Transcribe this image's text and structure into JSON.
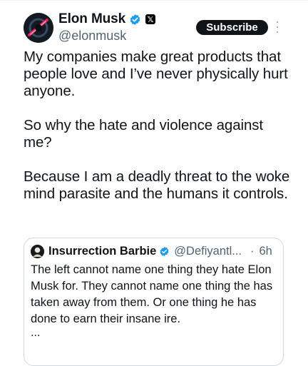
{
  "author": {
    "display_name": "Elon Musk",
    "handle": "@elonmusk",
    "badges": [
      "verified-badge-icon",
      "x-affiliate-icon"
    ]
  },
  "actions": {
    "subscribe_label": "Subscribe",
    "more_icon": "more-vertical-icon"
  },
  "tweet": {
    "paragraphs": [
      "My companies make great products that people love and I’ve never physically hurt anyone.",
      "So why the hate and violence against me?",
      "Because I am a deadly threat to the woke mind parasite and the humans it controls."
    ]
  },
  "quoted_tweet": {
    "display_name": "Insurrection Barbie",
    "handle": "@Defiyantl...",
    "separator": "·",
    "time": "6h",
    "text": "The left cannot name one thing they hate Elon Musk for. They cannot name one thing the has taken away from them. Or one thing he has done to earn their insane ire.",
    "ellipsis": "..."
  },
  "colors": {
    "text_primary": "#0f1419",
    "text_secondary": "#536471",
    "verified_blue": "#1d9bf0",
    "border": "#cfd9de",
    "button_bg": "#0f1419"
  }
}
